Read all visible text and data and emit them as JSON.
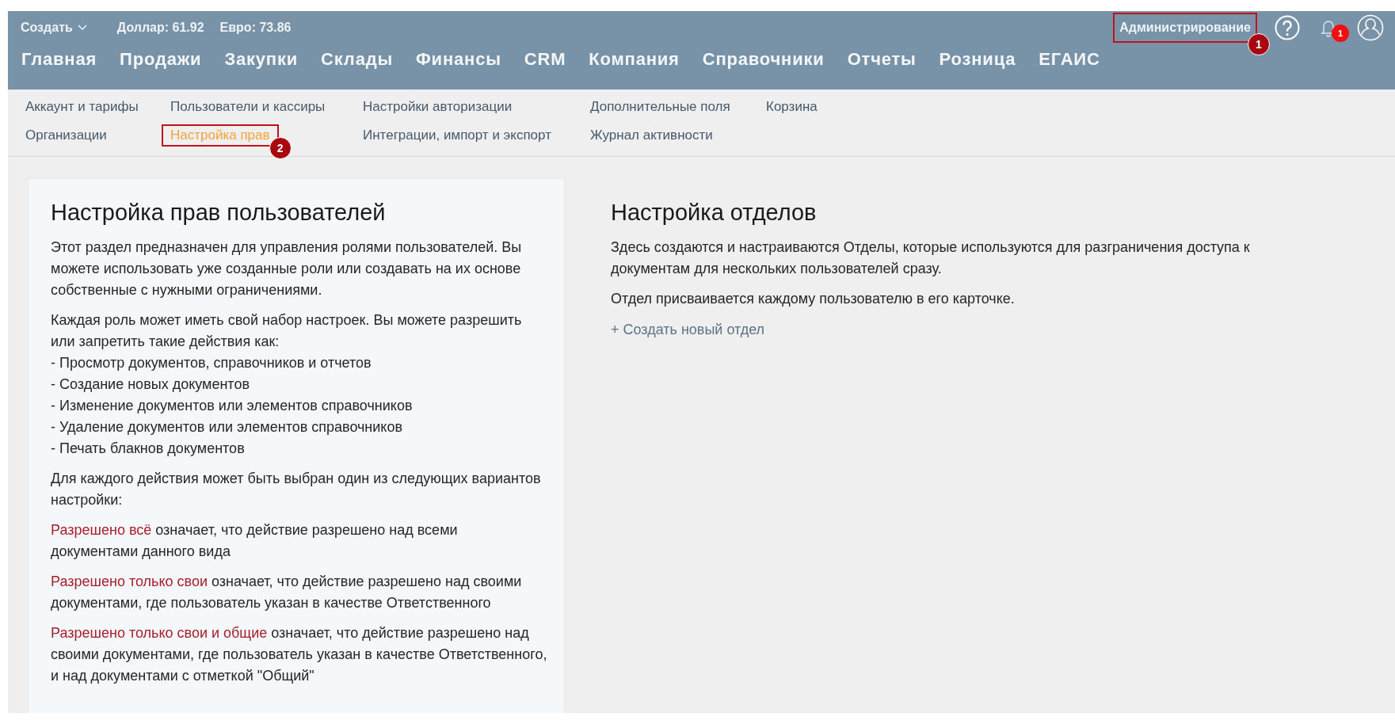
{
  "top_bar": {
    "create_menu": {
      "label": "Создать"
    },
    "rates": [
      "Доллар: 61.92",
      "Евро: 73.86"
    ],
    "admin_link": {
      "label": "Администрирование",
      "annotation": "1"
    },
    "notifications": {
      "badge": "1"
    }
  },
  "main_nav": [
    {
      "label": "Главная"
    },
    {
      "label": "Продажи"
    },
    {
      "label": "Закупки"
    },
    {
      "label": "Склады"
    },
    {
      "label": "Финансы"
    },
    {
      "label": "CRM"
    },
    {
      "label": "Компания"
    },
    {
      "label": "Справочники"
    },
    {
      "label": "Отчеты"
    },
    {
      "label": "Розница"
    },
    {
      "label": "ЕГАИС"
    }
  ],
  "sub_nav": [
    {
      "label": "Аккаунт и тарифы",
      "selected": false
    },
    {
      "label": "Пользователи и кассиры",
      "selected": false
    },
    {
      "label": "Настройки авторизации",
      "selected": false
    },
    {
      "label": "Дополнительные поля",
      "selected": false
    },
    {
      "label": "Корзина",
      "selected": false
    },
    {
      "label": "Организации",
      "selected": false
    },
    {
      "label": "Настройка прав",
      "selected": true,
      "annotation": "2"
    },
    {
      "label": "Интеграции, импорт и экспорт",
      "selected": false
    },
    {
      "label": "Журнал активности",
      "selected": false
    }
  ],
  "rights_card": {
    "title": "Настройка прав пользователей",
    "blocks": [
      {
        "text": "Этот раздел предназначен для управления ролями пользователей. Вы можете использовать уже созданные роли или создавать на их основе собственные с нужными ограничениями."
      },
      {
        "text": "Каждая роль может иметь свой набор настроек. Вы можете разрешить или запретить такие действия как:",
        "list": [
          "- Просмотр документов, справочников и отчетов",
          "- Создание новых документов",
          "- Изменение документов или элементов справочников",
          "- Удаление документов или элементов справочников",
          "- Печать блакнов документов"
        ]
      },
      {
        "text": "Для каждого действия может быть выбран один из следующих вариантов настройки:"
      },
      {
        "text": "**Разрешено всё** означает, что действие разрешено над всеми документами данного вида"
      },
      {
        "text": "**Разрешено только свои** означает, что действие разрешено над своими документами, где пользователь указан в качестве Ответственного"
      },
      {
        "text": "**Разрешено только свои и общие** означает, что действие разрешено над своими документами, где пользователь указан в качестве Ответственного, и над документами с отметкой \"Общий\""
      }
    ]
  },
  "departments": {
    "title": "Настройка отделов",
    "paragraphs": [
      "Здесь создаются и настраиваются Отделы, которые используются для разграничения доступа к документам для нескольких пользователей сразу.",
      "Отдел присваивается каждому пользователю в его карточке."
    ],
    "create_link": "+ Создать новый отдел"
  }
}
